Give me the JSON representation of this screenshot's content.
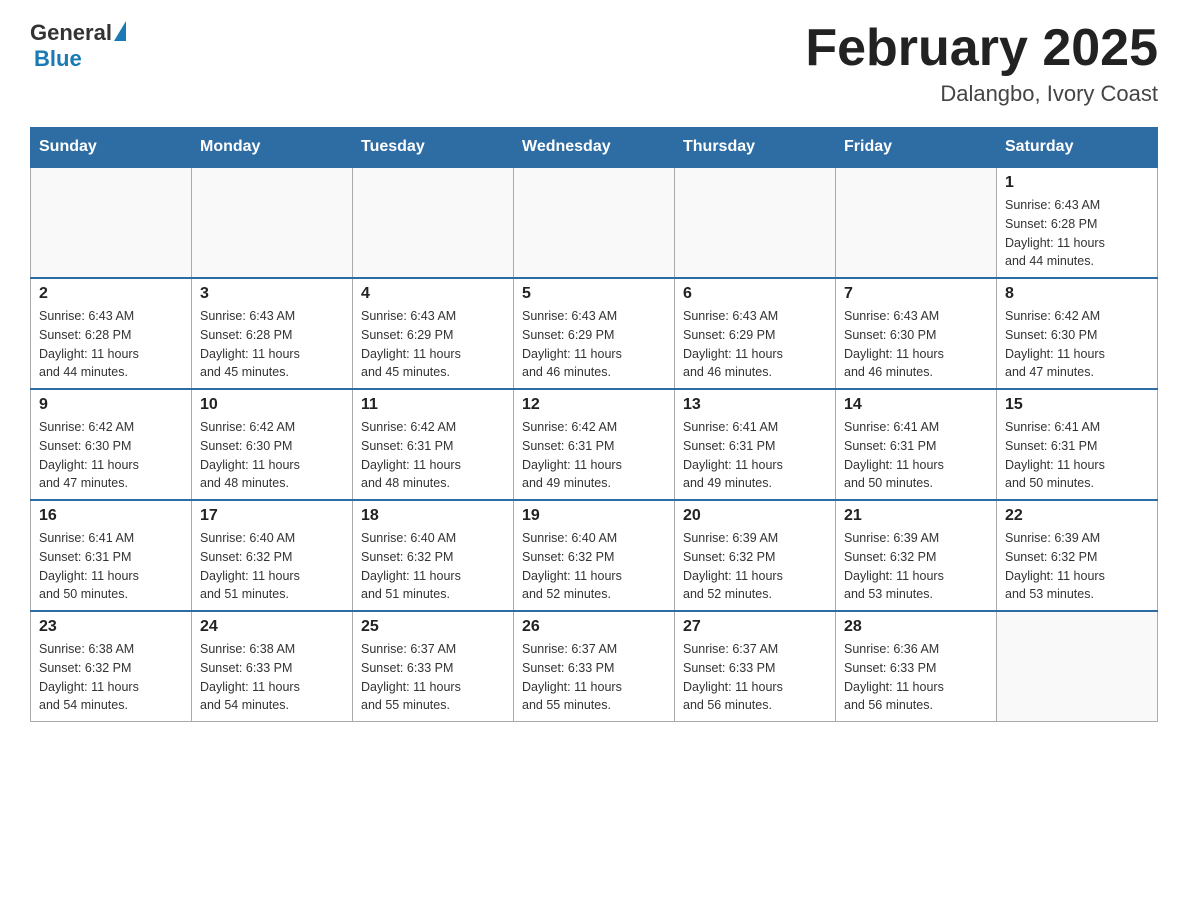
{
  "header": {
    "logo_general": "General",
    "logo_blue": "Blue",
    "title": "February 2025",
    "subtitle": "Dalangbo, Ivory Coast"
  },
  "weekdays": [
    "Sunday",
    "Monday",
    "Tuesday",
    "Wednesday",
    "Thursday",
    "Friday",
    "Saturday"
  ],
  "weeks": [
    [
      {
        "day": "",
        "info": ""
      },
      {
        "day": "",
        "info": ""
      },
      {
        "day": "",
        "info": ""
      },
      {
        "day": "",
        "info": ""
      },
      {
        "day": "",
        "info": ""
      },
      {
        "day": "",
        "info": ""
      },
      {
        "day": "1",
        "info": "Sunrise: 6:43 AM\nSunset: 6:28 PM\nDaylight: 11 hours\nand 44 minutes."
      }
    ],
    [
      {
        "day": "2",
        "info": "Sunrise: 6:43 AM\nSunset: 6:28 PM\nDaylight: 11 hours\nand 44 minutes."
      },
      {
        "day": "3",
        "info": "Sunrise: 6:43 AM\nSunset: 6:28 PM\nDaylight: 11 hours\nand 45 minutes."
      },
      {
        "day": "4",
        "info": "Sunrise: 6:43 AM\nSunset: 6:29 PM\nDaylight: 11 hours\nand 45 minutes."
      },
      {
        "day": "5",
        "info": "Sunrise: 6:43 AM\nSunset: 6:29 PM\nDaylight: 11 hours\nand 46 minutes."
      },
      {
        "day": "6",
        "info": "Sunrise: 6:43 AM\nSunset: 6:29 PM\nDaylight: 11 hours\nand 46 minutes."
      },
      {
        "day": "7",
        "info": "Sunrise: 6:43 AM\nSunset: 6:30 PM\nDaylight: 11 hours\nand 46 minutes."
      },
      {
        "day": "8",
        "info": "Sunrise: 6:42 AM\nSunset: 6:30 PM\nDaylight: 11 hours\nand 47 minutes."
      }
    ],
    [
      {
        "day": "9",
        "info": "Sunrise: 6:42 AM\nSunset: 6:30 PM\nDaylight: 11 hours\nand 47 minutes."
      },
      {
        "day": "10",
        "info": "Sunrise: 6:42 AM\nSunset: 6:30 PM\nDaylight: 11 hours\nand 48 minutes."
      },
      {
        "day": "11",
        "info": "Sunrise: 6:42 AM\nSunset: 6:31 PM\nDaylight: 11 hours\nand 48 minutes."
      },
      {
        "day": "12",
        "info": "Sunrise: 6:42 AM\nSunset: 6:31 PM\nDaylight: 11 hours\nand 49 minutes."
      },
      {
        "day": "13",
        "info": "Sunrise: 6:41 AM\nSunset: 6:31 PM\nDaylight: 11 hours\nand 49 minutes."
      },
      {
        "day": "14",
        "info": "Sunrise: 6:41 AM\nSunset: 6:31 PM\nDaylight: 11 hours\nand 50 minutes."
      },
      {
        "day": "15",
        "info": "Sunrise: 6:41 AM\nSunset: 6:31 PM\nDaylight: 11 hours\nand 50 minutes."
      }
    ],
    [
      {
        "day": "16",
        "info": "Sunrise: 6:41 AM\nSunset: 6:31 PM\nDaylight: 11 hours\nand 50 minutes."
      },
      {
        "day": "17",
        "info": "Sunrise: 6:40 AM\nSunset: 6:32 PM\nDaylight: 11 hours\nand 51 minutes."
      },
      {
        "day": "18",
        "info": "Sunrise: 6:40 AM\nSunset: 6:32 PM\nDaylight: 11 hours\nand 51 minutes."
      },
      {
        "day": "19",
        "info": "Sunrise: 6:40 AM\nSunset: 6:32 PM\nDaylight: 11 hours\nand 52 minutes."
      },
      {
        "day": "20",
        "info": "Sunrise: 6:39 AM\nSunset: 6:32 PM\nDaylight: 11 hours\nand 52 minutes."
      },
      {
        "day": "21",
        "info": "Sunrise: 6:39 AM\nSunset: 6:32 PM\nDaylight: 11 hours\nand 53 minutes."
      },
      {
        "day": "22",
        "info": "Sunrise: 6:39 AM\nSunset: 6:32 PM\nDaylight: 11 hours\nand 53 minutes."
      }
    ],
    [
      {
        "day": "23",
        "info": "Sunrise: 6:38 AM\nSunset: 6:32 PM\nDaylight: 11 hours\nand 54 minutes."
      },
      {
        "day": "24",
        "info": "Sunrise: 6:38 AM\nSunset: 6:33 PM\nDaylight: 11 hours\nand 54 minutes."
      },
      {
        "day": "25",
        "info": "Sunrise: 6:37 AM\nSunset: 6:33 PM\nDaylight: 11 hours\nand 55 minutes."
      },
      {
        "day": "26",
        "info": "Sunrise: 6:37 AM\nSunset: 6:33 PM\nDaylight: 11 hours\nand 55 minutes."
      },
      {
        "day": "27",
        "info": "Sunrise: 6:37 AM\nSunset: 6:33 PM\nDaylight: 11 hours\nand 56 minutes."
      },
      {
        "day": "28",
        "info": "Sunrise: 6:36 AM\nSunset: 6:33 PM\nDaylight: 11 hours\nand 56 minutes."
      },
      {
        "day": "",
        "info": ""
      }
    ]
  ]
}
